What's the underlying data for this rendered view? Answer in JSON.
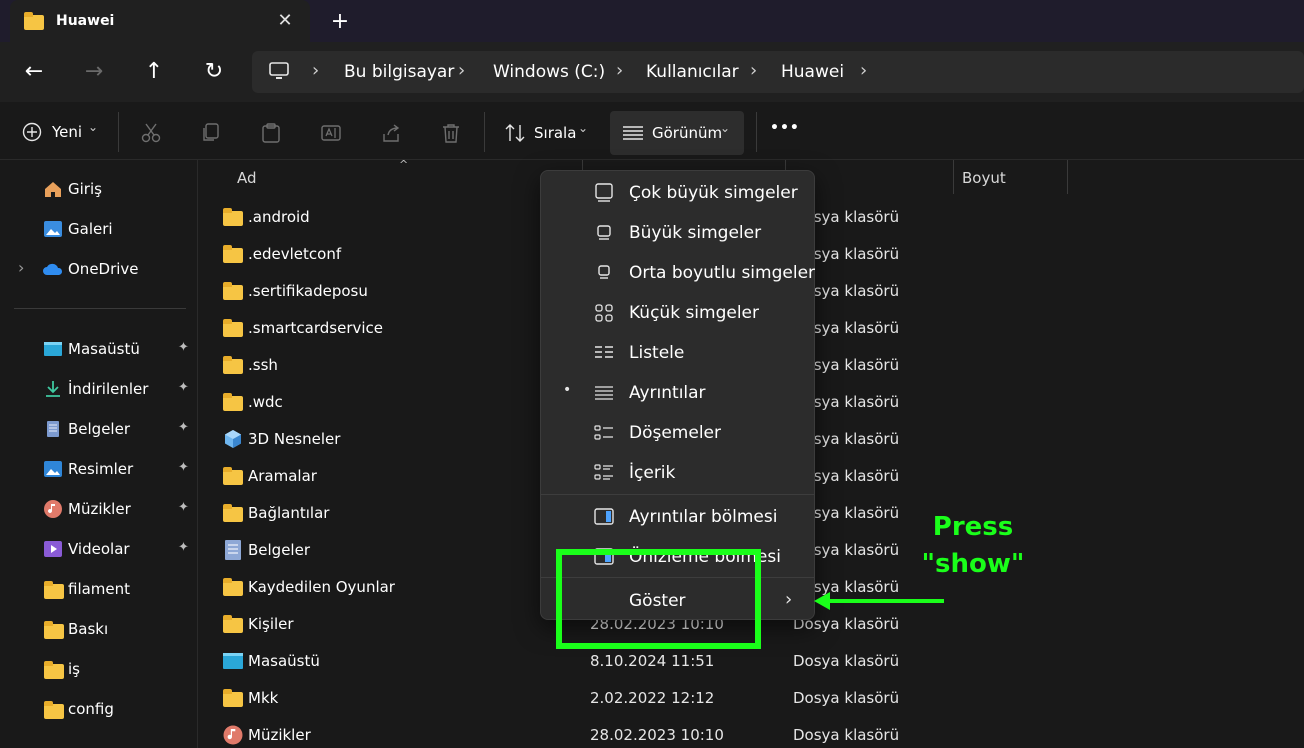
{
  "window": {
    "tab_title": "Huawei",
    "close_glyph": "✕",
    "new_tab_glyph": "+"
  },
  "nav": {
    "back": "←",
    "forward": "→",
    "up": "↑",
    "refresh": "↻",
    "breadcrumb": [
      "Bu bilgisayar",
      "Windows (C:)",
      "Kullanıcılar",
      "Huawei"
    ],
    "chevron": "›"
  },
  "toolbar": {
    "new_label": "Yeni",
    "sort_label": "Sırala",
    "view_label": "Görünüm",
    "more_label": "•••",
    "caret": "⌄"
  },
  "sidebar": {
    "items": [
      {
        "label": "Giriş",
        "icon": "home-icon",
        "pinned": false
      },
      {
        "label": "Galeri",
        "icon": "gallery-icon",
        "pinned": false
      },
      {
        "label": "OneDrive",
        "icon": "onedrive-icon",
        "pinned": false
      },
      {
        "label": "Masaüstü",
        "icon": "desktop-icon",
        "pinned": true
      },
      {
        "label": "İndirilenler",
        "icon": "download-icon",
        "pinned": true
      },
      {
        "label": "Belgeler",
        "icon": "documents-icon",
        "pinned": true
      },
      {
        "label": "Resimler",
        "icon": "pictures-icon",
        "pinned": true
      },
      {
        "label": "Müzikler",
        "icon": "music-icon",
        "pinned": true
      },
      {
        "label": "Videolar",
        "icon": "videos-icon",
        "pinned": true
      },
      {
        "label": "filament",
        "icon": "folder-icon",
        "pinned": false
      },
      {
        "label": "Baskı",
        "icon": "folder-icon",
        "pinned": false
      },
      {
        "label": "iş",
        "icon": "folder-icon",
        "pinned": false
      },
      {
        "label": "config",
        "icon": "folder-icon",
        "pinned": false
      }
    ],
    "pin_glyph": "📌",
    "expand_glyph": "›"
  },
  "content": {
    "columns": {
      "name": "Ad",
      "size": "Boyut"
    },
    "rows": [
      {
        "name": ".android",
        "date": "",
        "type": "Dosya klasörü"
      },
      {
        "name": ".edevletconf",
        "date": "",
        "type": "Dosya klasörü"
      },
      {
        "name": ".sertifikadeposu",
        "date": "",
        "type": "Dosya klasörü"
      },
      {
        "name": ".smartcardservice",
        "date": "",
        "type": "Dosya klasörü"
      },
      {
        "name": ".ssh",
        "date": "",
        "type": "Dosya klasörü"
      },
      {
        "name": ".wdc",
        "date": "",
        "type": "Dosya klasörü"
      },
      {
        "name": "3D Nesneler",
        "date": "",
        "type": "Dosya klasörü"
      },
      {
        "name": "Aramalar",
        "date": "",
        "type": "Dosya klasörü"
      },
      {
        "name": "Bağlantılar",
        "date": "",
        "type": "Dosya klasörü"
      },
      {
        "name": "Belgeler",
        "date": "",
        "type": "Dosya klasörü"
      },
      {
        "name": "Kaydedilen Oyunlar",
        "date": "",
        "type": "Dosya klasörü"
      },
      {
        "name": "Kişiler",
        "date": "28.02.2023 10:10",
        "type": "Dosya klasörü"
      },
      {
        "name": "Masaüstü",
        "date": "8.10.2024 11:51",
        "type": "Dosya klasörü"
      },
      {
        "name": "Mkk",
        "date": "2.02.2022 12:12",
        "type": "Dosya klasörü"
      },
      {
        "name": "Müzikler",
        "date": "28.02.2023 10:10",
        "type": "Dosya klasörü"
      }
    ]
  },
  "view_menu": {
    "items": [
      {
        "label": "Çok büyük simgeler",
        "icon": "extra-large-icons-icon"
      },
      {
        "label": "Büyük simgeler",
        "icon": "large-icons-icon"
      },
      {
        "label": "Orta boyutlu simgeler",
        "icon": "medium-icons-icon"
      },
      {
        "label": "Küçük simgeler",
        "icon": "small-icons-icon"
      },
      {
        "label": "Listele",
        "icon": "list-icon"
      },
      {
        "label": "Ayrıntılar",
        "icon": "details-icon",
        "selected": true
      },
      {
        "label": "Döşemeler",
        "icon": "tiles-icon"
      },
      {
        "label": "İçerik",
        "icon": "content-icon"
      }
    ],
    "panes": [
      {
        "label": "Ayrıntılar bölmesi",
        "icon": "details-pane-icon"
      },
      {
        "label": "Önizleme bölmesi",
        "icon": "preview-pane-icon"
      }
    ],
    "show_label": "Göster",
    "submenu_glyph": "›",
    "bullet": "•"
  },
  "annotation": {
    "line1": "Press",
    "line2": "\"show\"",
    "color": "#1aff1a"
  }
}
